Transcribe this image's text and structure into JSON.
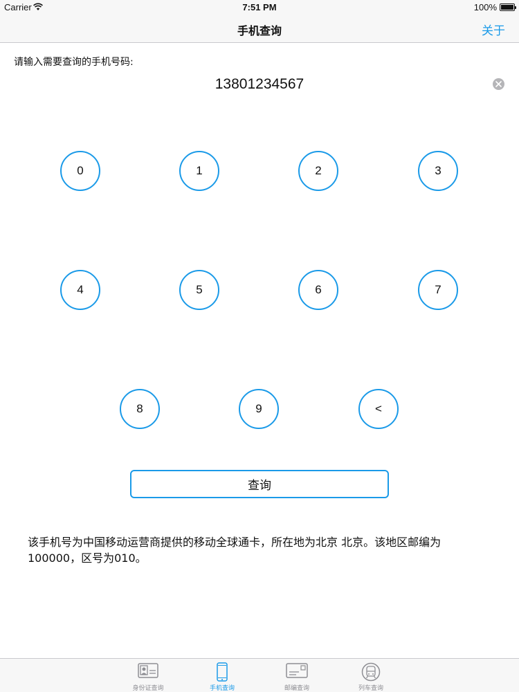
{
  "status_bar": {
    "carrier": "Carrier",
    "time": "7:51 PM",
    "battery": "100%"
  },
  "nav": {
    "title": "手机查询",
    "about": "关于"
  },
  "input": {
    "prompt": "请输入需要查询的手机号码:",
    "value": "13801234567"
  },
  "keypad": {
    "keys": [
      "0",
      "1",
      "2",
      "3",
      "4",
      "5",
      "6",
      "7",
      "8",
      "9",
      "<"
    ]
  },
  "query_button": "查询",
  "result": "该手机号为中国移动运营商提供的移动全球通卡，所在地为北京 北京。该地区邮编为100000，区号为010。",
  "tabs": [
    {
      "label": "身份证查询",
      "icon": "id-card-icon",
      "active": false
    },
    {
      "label": "手机查询",
      "icon": "mobile-phone-icon",
      "active": true
    },
    {
      "label": "邮编查询",
      "icon": "postcard-icon",
      "active": false
    },
    {
      "label": "列车查询",
      "icon": "train-icon",
      "active": false
    }
  ],
  "colors": {
    "accent": "#1a9ae8",
    "text": "#111111",
    "bar_background": "#f7f7f7"
  }
}
